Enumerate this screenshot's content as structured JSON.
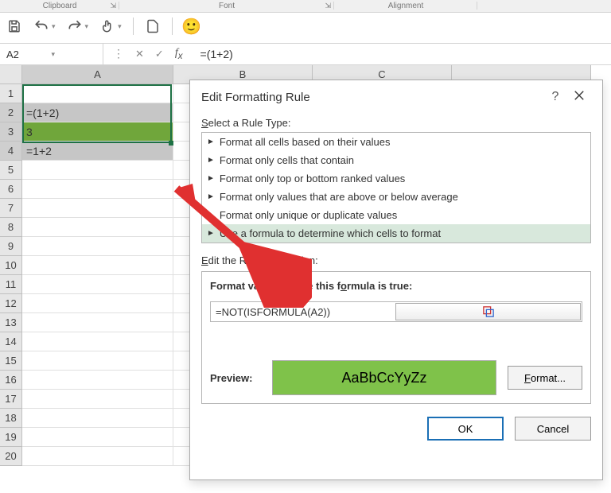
{
  "ribbon": {
    "clipboard": "Clipboard",
    "font": "Font",
    "alignment": "Alignment"
  },
  "namebox": "A2",
  "formula": "=(1+2)",
  "columns": [
    "A",
    "B",
    "C"
  ],
  "rows_count": 20,
  "cells": {
    "A2": "=(1+2)",
    "A3": "3",
    "A4": "=1+2"
  },
  "dialog": {
    "title": "Edit Formatting Rule",
    "select_label": "Select a Rule Type:",
    "rule_types": [
      "Format all cells based on their values",
      "Format only cells that contain",
      "Format only top or bottom ranked values",
      "Format only values that are above or below average",
      "Format only unique or duplicate values",
      "Use a formula to determine which cells to format"
    ],
    "selected_rule_index": 5,
    "edit_desc_label": "Edit the Rule Description:",
    "desc_title": "Format values where this formula is true:",
    "formula_value": "=NOT(ISFORMULA(A2))",
    "preview_label": "Preview:",
    "preview_sample": "AaBbCcYyZz",
    "format_btn": "Format...",
    "ok": "OK",
    "cancel": "Cancel"
  }
}
